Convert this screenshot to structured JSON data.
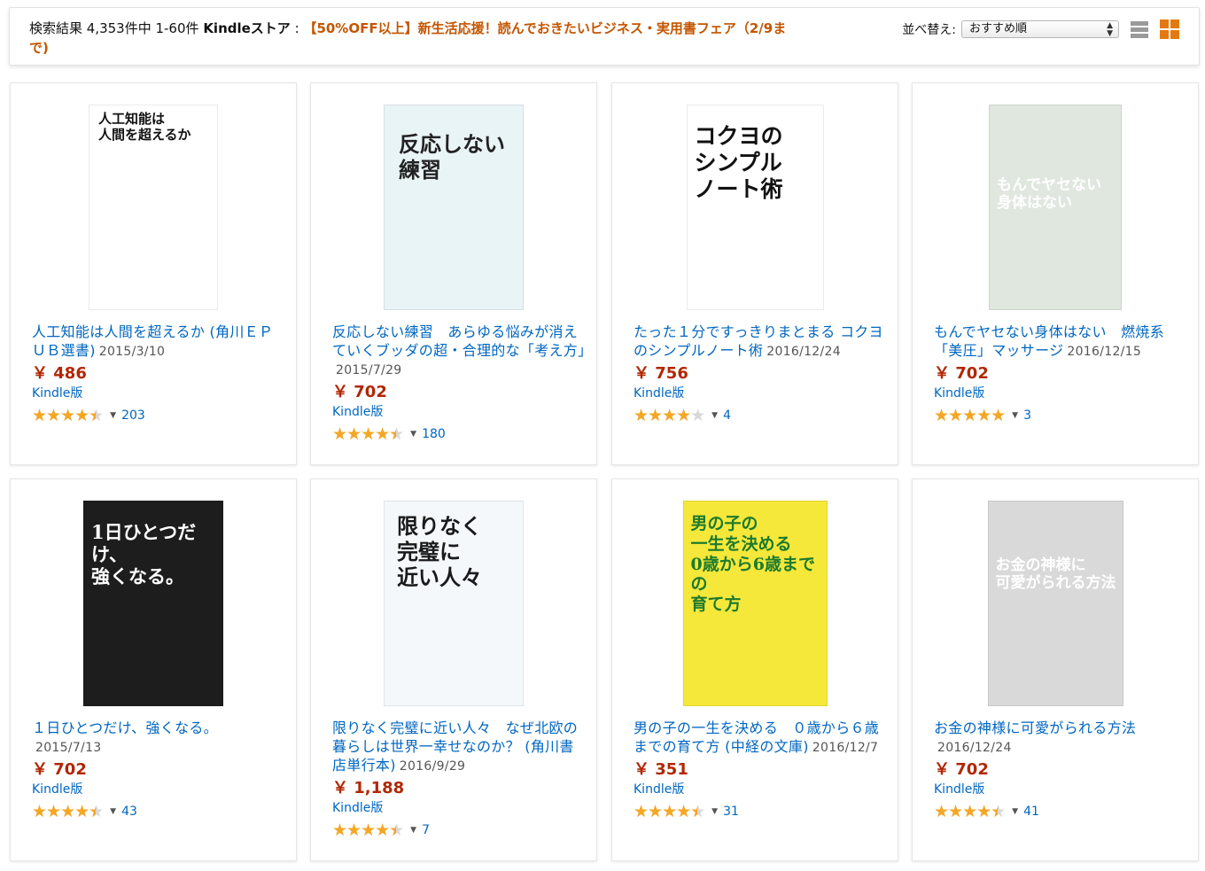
{
  "results_bar": {
    "count_text": "検索結果 4,353件中 1-60件",
    "store_text": "Kindleストア",
    "separator": ":",
    "promo_text": "【50%OFF以上】新生活応援！読んでおきたいビジネス・実用書フェア（2/9まで)",
    "sort_label": "並べ替え:",
    "sort_value": "おすすめ順",
    "list_view_icon": "list-view-icon",
    "grid_view_icon": "grid-view-icon",
    "accent_color": "#e47911"
  },
  "products": [
    {
      "title": "人工知能は人間を超えるか (角川ＥＰＵＢ選書)",
      "date": "2015/3/10",
      "price": "￥ 486",
      "format": "Kindle版",
      "rating": 4.5,
      "reviews": "203",
      "cover_color": "#ffffff",
      "cover_text": "人工知能は\n人間を超えるか",
      "cover_text_color": "#111111"
    },
    {
      "title": "反応しない練習　あらゆる悩みが消えていくブッダの超・合理的な「考え方」",
      "date": "2015/7/29",
      "price": "￥ 702",
      "format": "Kindle版",
      "rating": 4.5,
      "reviews": "180",
      "cover_color": "#e9f4f7",
      "cover_text": "反応しない\n練習",
      "cover_text_color": "#222222"
    },
    {
      "title": "たった１分ですっきりまとまる コクヨのシンプルノート術",
      "date": "2016/12/24",
      "price": "￥ 756",
      "format": "Kindle版",
      "rating": 4,
      "reviews": "4",
      "cover_color": "#ffffff",
      "cover_text": "コクヨの\nシンプル\nノート術",
      "cover_text_color": "#111111"
    },
    {
      "title": "もんでヤセない身体はない　燃焼系「美圧」マッサージ",
      "date": "2016/12/15",
      "price": "￥ 702",
      "format": "Kindle版",
      "rating": 5,
      "reviews": "3",
      "cover_color": "#dfe7df",
      "cover_text": "もんでヤセない\n身体はない",
      "cover_text_color": "#ffffff"
    },
    {
      "title": "１日ひとつだけ、強くなる。",
      "date": "2015/7/13",
      "price": "￥ 702",
      "format": "Kindle版",
      "rating": 4.5,
      "reviews": "43",
      "cover_color": "#1d1d1d",
      "cover_text": "1日ひとつだけ、\n強くなる。",
      "cover_text_color": "#ffffff"
    },
    {
      "title": "限りなく完璧に近い人々　なぜ北欧の暮らしは世界一幸せなのか？ (角川書店単行本)",
      "date": "2016/9/29",
      "price": "￥ 1,188",
      "format": "Kindle版",
      "rating": 4.5,
      "reviews": "7",
      "cover_color": "#f4f8fb",
      "cover_text": "限りなく\n完璧に\n近い人々",
      "cover_text_color": "#1a1a1a"
    },
    {
      "title": "男の子の一生を決める　０歳から６歳までの育て方 (中経の文庫)",
      "date": "2016/12/7",
      "price": "￥ 351",
      "format": "Kindle版",
      "rating": 4.5,
      "reviews": "31",
      "cover_color": "#f5e83a",
      "cover_text": "男の子の\n一生を決める\n0歳から6歳までの\n育て方",
      "cover_text_color": "#1d7a2e"
    },
    {
      "title": "お金の神様に可愛がられる方法",
      "date": "2016/12/24",
      "price": "￥ 702",
      "format": "Kindle版",
      "rating": 4.5,
      "reviews": "41",
      "cover_color": "#d9d9d9",
      "cover_text": "お金の神様に\n可愛がられる方法",
      "cover_text_color": "#ffffff"
    }
  ]
}
